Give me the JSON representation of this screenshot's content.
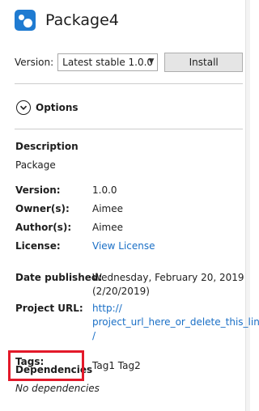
{
  "header": {
    "title": "Package4",
    "icon": "nuget-package-icon"
  },
  "version": {
    "label": "Version:",
    "selected": "Latest stable 1.0.0",
    "install_label": "Install"
  },
  "options": {
    "label": "Options",
    "icon": "chevron-down-circle-icon"
  },
  "description": {
    "title": "Description",
    "text": "Package"
  },
  "fields": {
    "version": {
      "label": "Version:",
      "value": "1.0.0"
    },
    "owners": {
      "label": "Owner(s):",
      "value": "Aimee"
    },
    "authors": {
      "label": "Author(s):",
      "value": "Aimee"
    },
    "license": {
      "label": "License:",
      "value": "View License"
    },
    "date_published": {
      "label": "Date published:",
      "value_line1": "Wednesday, February 20, 2019",
      "value_line2": "(2/20/2019)"
    },
    "project_url": {
      "label": "Project URL:",
      "value_line1": "http://",
      "value_line2": "project_url_here_or_delete_this_line",
      "value_line3": "/"
    },
    "tags": {
      "label": "Tags:",
      "value": "Tag1 Tag2"
    }
  },
  "dependencies": {
    "label": "Dependencies",
    "empty_text": "No dependencies"
  },
  "colors": {
    "link": "#1a6fc6",
    "highlight": "#e3192a",
    "icon": "#1f7bd1"
  }
}
